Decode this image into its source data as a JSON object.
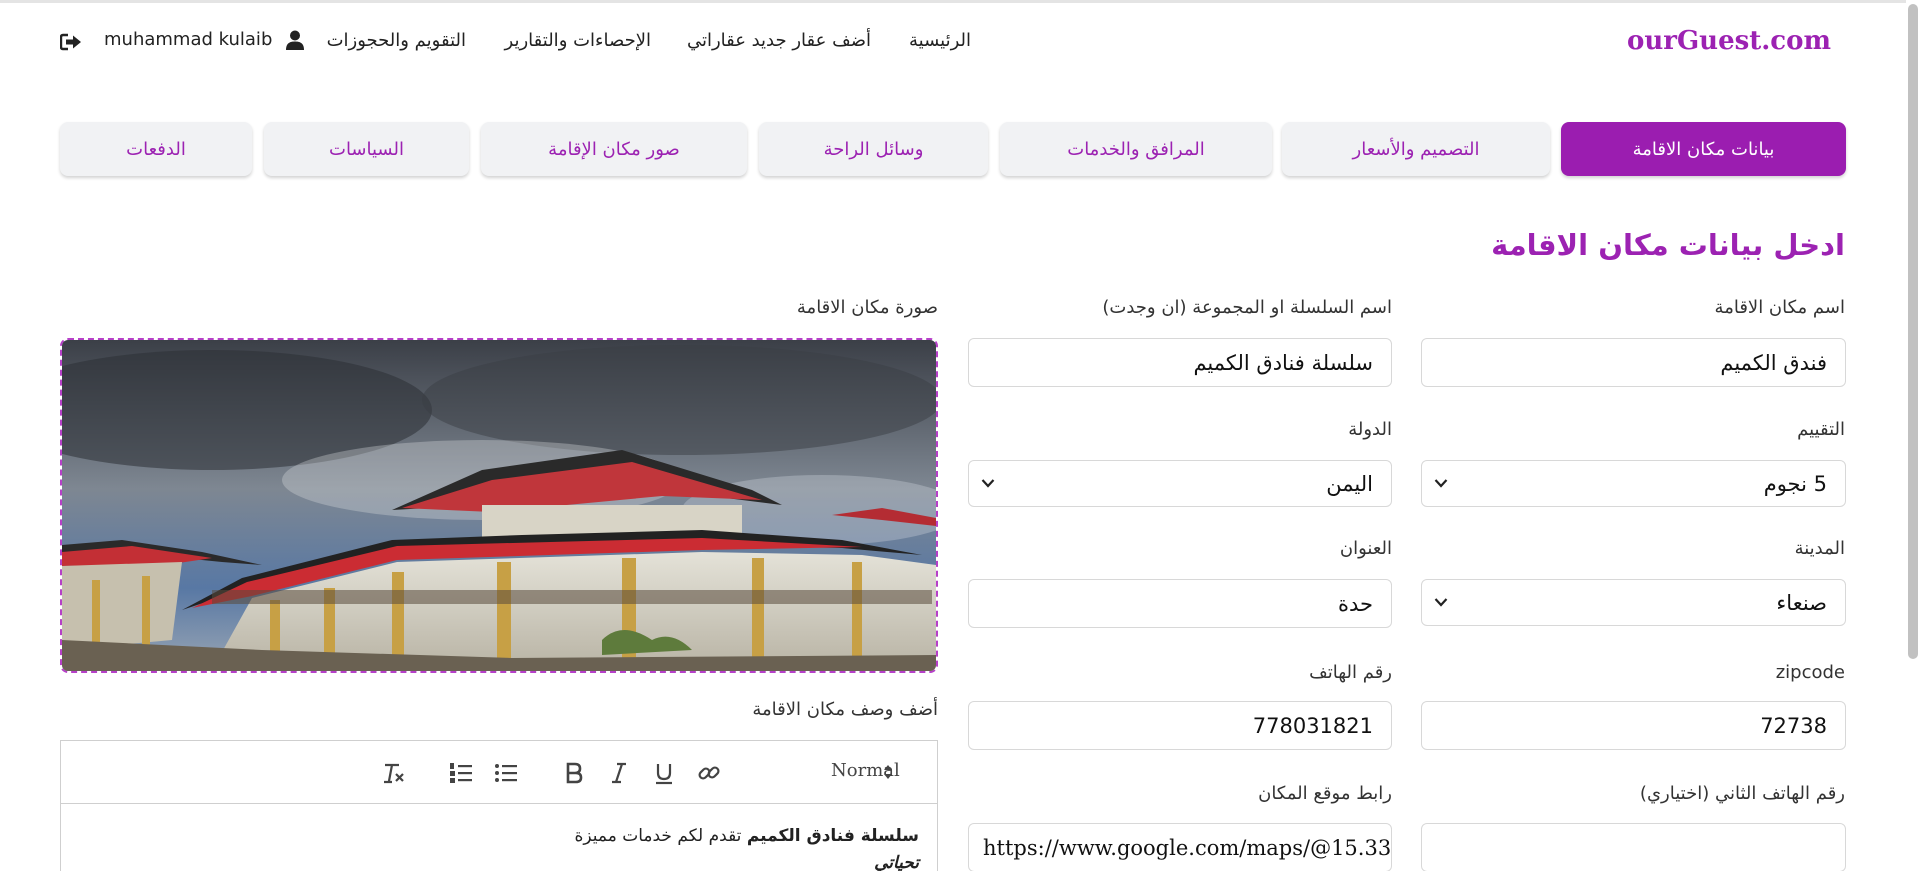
{
  "brand": "ourGuest.com",
  "nav": {
    "home": "الرئيسية",
    "add_property": "أضف عقار جديد",
    "my_properties": "عقاراتي",
    "stats": "الإحصاءات والتقارير",
    "calendar": "التقويم والحجوزات",
    "user_name": "muhammad kulaib"
  },
  "tabs": [
    "بيانات مكان الاقامة",
    "التصميم والأسعار",
    "المرافق والخدمات",
    "وسائل الراحة",
    "صور مكان الإقامة",
    "السياسات",
    "الدفعات"
  ],
  "active_tab": 0,
  "section_title": "ادخل بيانات مكان الاقامة",
  "form": {
    "name_label": "اسم مكان الاقامة",
    "name_value": "فندق الكميم",
    "chain_label": "اسم السلسلة او المجموعة (ان وجدت)",
    "chain_value": "سلسلة فنادق الكميم",
    "rating_label": "التقييم",
    "rating_value": "5 نجوم",
    "country_label": "الدولة",
    "country_value": "اليمن",
    "city_label": "المدينة",
    "city_value": "صنعاء",
    "address_label": "العنوان",
    "address_value": "حدة",
    "zipcode_label": "zipcode",
    "zipcode_value": "72738",
    "phone_label": "رقم الهاتف",
    "phone_value": "778031821",
    "phone2_label": "رقم الهاتف الثاني (اختياري)",
    "phone2_value": "",
    "map_label": "رابط موقع المكان",
    "map_value": "https://www.google.com/maps/@15.33"
  },
  "image_label": "صورة مكان الاقامة",
  "editor": {
    "label": "أضف وصف مكان الاقامة",
    "format": "Normal",
    "line1_bold": "سلسلة فنادق الكميم",
    "line1_rest": " تقدم لكم خدمات مميزة",
    "line2_italic": "تحياتي"
  },
  "colors": {
    "accent": "#9c22b2",
    "tab_bg": "#f1f2f4"
  }
}
